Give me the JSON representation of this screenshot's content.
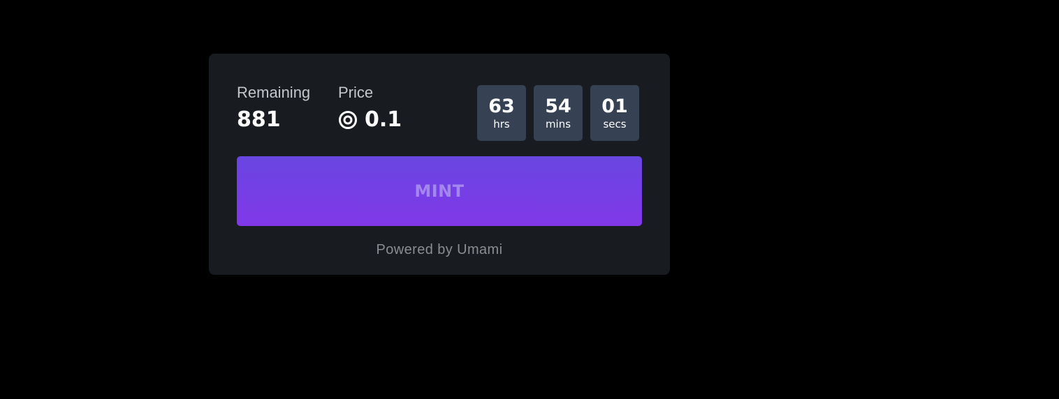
{
  "stats": {
    "remaining": {
      "label": "Remaining",
      "value": "881"
    },
    "price": {
      "label": "Price",
      "value": "0.1",
      "currency_icon": "solana-ring-icon"
    }
  },
  "countdown": [
    {
      "value": "63",
      "unit": "hrs"
    },
    {
      "value": "54",
      "unit": "mins"
    },
    {
      "value": "01",
      "unit": "secs"
    }
  ],
  "mint_button": {
    "label": "MINT"
  },
  "footer": {
    "powered_by": "Powered by Umami"
  },
  "colors": {
    "page_background": "#000000",
    "card_background": "#181c21",
    "countdown_box": "#364253",
    "button_gradient_top": "#6846e0",
    "button_gradient_bottom": "#8238e9",
    "button_text": "#a387ee"
  }
}
